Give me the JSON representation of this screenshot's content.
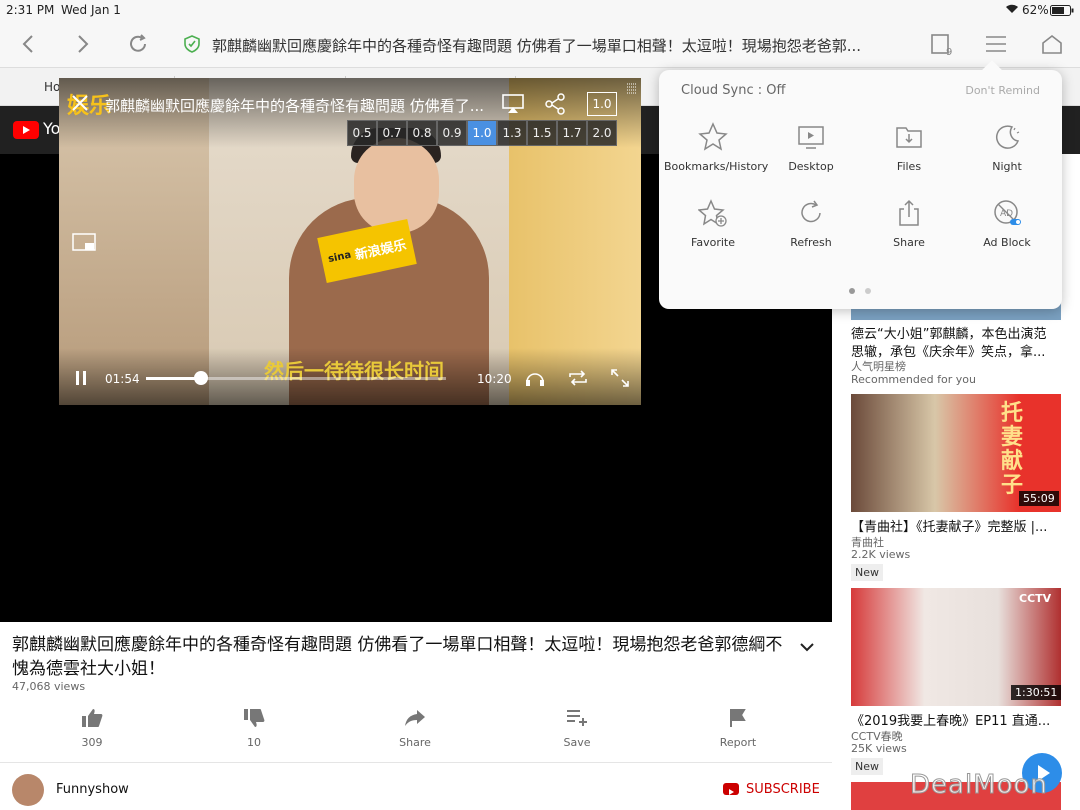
{
  "status": {
    "time": "2:31 PM",
    "date": "Wed Jan 1",
    "battery": "62%"
  },
  "toolbar": {
    "page_title": "郭麒麟幽默回應慶餘年中的各種奇怪有趣問題 仿佛看了一場單口相聲！太逗啦！現場抱怨老爸郭...",
    "tab_count": "9"
  },
  "tabs": {
    "first_tab": "Ho"
  },
  "player": {
    "title": "郭麒麟幽默回應慶餘年中的各種奇怪有趣問題 仿佛看了...",
    "speed_badge": "1.0",
    "speeds": [
      "0.5",
      "0.7",
      "0.8",
      "0.9",
      "1.0",
      "1.3",
      "1.5",
      "1.7",
      "2.0"
    ],
    "selected_speed": "1.0",
    "current_time": "01:54",
    "total_time": "10:20",
    "progress": 0.184,
    "sign_text": "新浪娱乐",
    "sign_brand": "sina",
    "subtitle": "然后一待待很长时间",
    "logo_text": "娱乐"
  },
  "video": {
    "title": "郭麒麟幽默回應慶餘年中的各種奇怪有趣問題 仿佛看了一場單口相聲！太逗啦！現場抱怨老爸郭德綱不愧為德雲社大小姐！",
    "views": "47,068 views"
  },
  "actions": [
    {
      "label": "309",
      "icon": "thumb-up-icon"
    },
    {
      "label": "10",
      "icon": "thumb-down-icon"
    },
    {
      "label": "Share",
      "icon": "share-icon"
    },
    {
      "label": "Save",
      "icon": "playlist-add-icon"
    },
    {
      "label": "Report",
      "icon": "flag-icon"
    }
  ],
  "channel": {
    "name": "Funnyshow",
    "subscribe": "SUBSCRIBE"
  },
  "menu": {
    "cloud_sync": "Cloud Sync : Off",
    "dont_remind": "Don't Remind",
    "items": [
      {
        "label": "Bookmarks/History",
        "icon": "star-icon"
      },
      {
        "label": "Desktop",
        "icon": "desktop-icon"
      },
      {
        "label": "Files",
        "icon": "folder-icon"
      },
      {
        "label": "Night",
        "icon": "moon-icon"
      },
      {
        "label": "Favorite",
        "icon": "star-plus-icon"
      },
      {
        "label": "Refresh",
        "icon": "refresh-icon"
      },
      {
        "label": "Share",
        "icon": "share-box-icon"
      },
      {
        "label": "Ad Block",
        "icon": "ad-block-icon"
      }
    ]
  },
  "related": [
    {
      "title": "德云“大小姐”郭麒麟，本色出演范",
      "title2": "思辙，承包《庆余年》笑点，拿...",
      "channel": "人气明星榜",
      "meta": "Recommended for you",
      "duration": ""
    },
    {
      "title": "【青曲社】《托妻献子》完整版 |...",
      "channel": "青曲社",
      "meta": "2.2K views",
      "badge": "New",
      "duration": "55:09",
      "thumb_text": "托妻献子"
    },
    {
      "title": "《2019我要上春晚》EP11 直通...",
      "channel": "CCTV春晚",
      "meta": "25K views",
      "badge": "New",
      "duration": "1:30:51",
      "thumb_text": "CCTV"
    }
  ],
  "watermark": "DealMoon",
  "colors": {
    "accent": "#4a90e2",
    "yt_red": "#ff0000",
    "subscribe": "#cc0000"
  }
}
